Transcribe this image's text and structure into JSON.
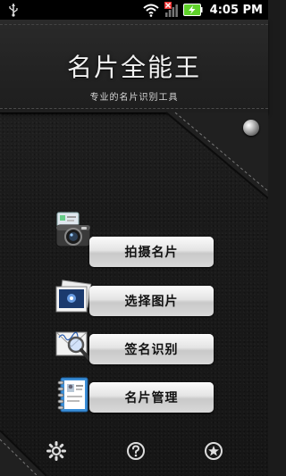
{
  "statusbar": {
    "time": "4:05",
    "ampm": "PM"
  },
  "header": {
    "title": "名片全能王",
    "subtitle": "专业的名片识别工具"
  },
  "menu": {
    "items": [
      {
        "label": "拍摄名片",
        "icon": "camera-icon"
      },
      {
        "label": "选择图片",
        "icon": "photo-icon"
      },
      {
        "label": "签名识别",
        "icon": "signature-magnifier-icon"
      },
      {
        "label": "名片管理",
        "icon": "address-book-icon"
      }
    ]
  },
  "bottom": {
    "icons": [
      "settings-gear-icon",
      "help-icon",
      "favorite-star-icon"
    ]
  },
  "colors": {
    "background": "#1b1b1b",
    "button": "#e4e4e4",
    "battery": "#5fd12a"
  }
}
